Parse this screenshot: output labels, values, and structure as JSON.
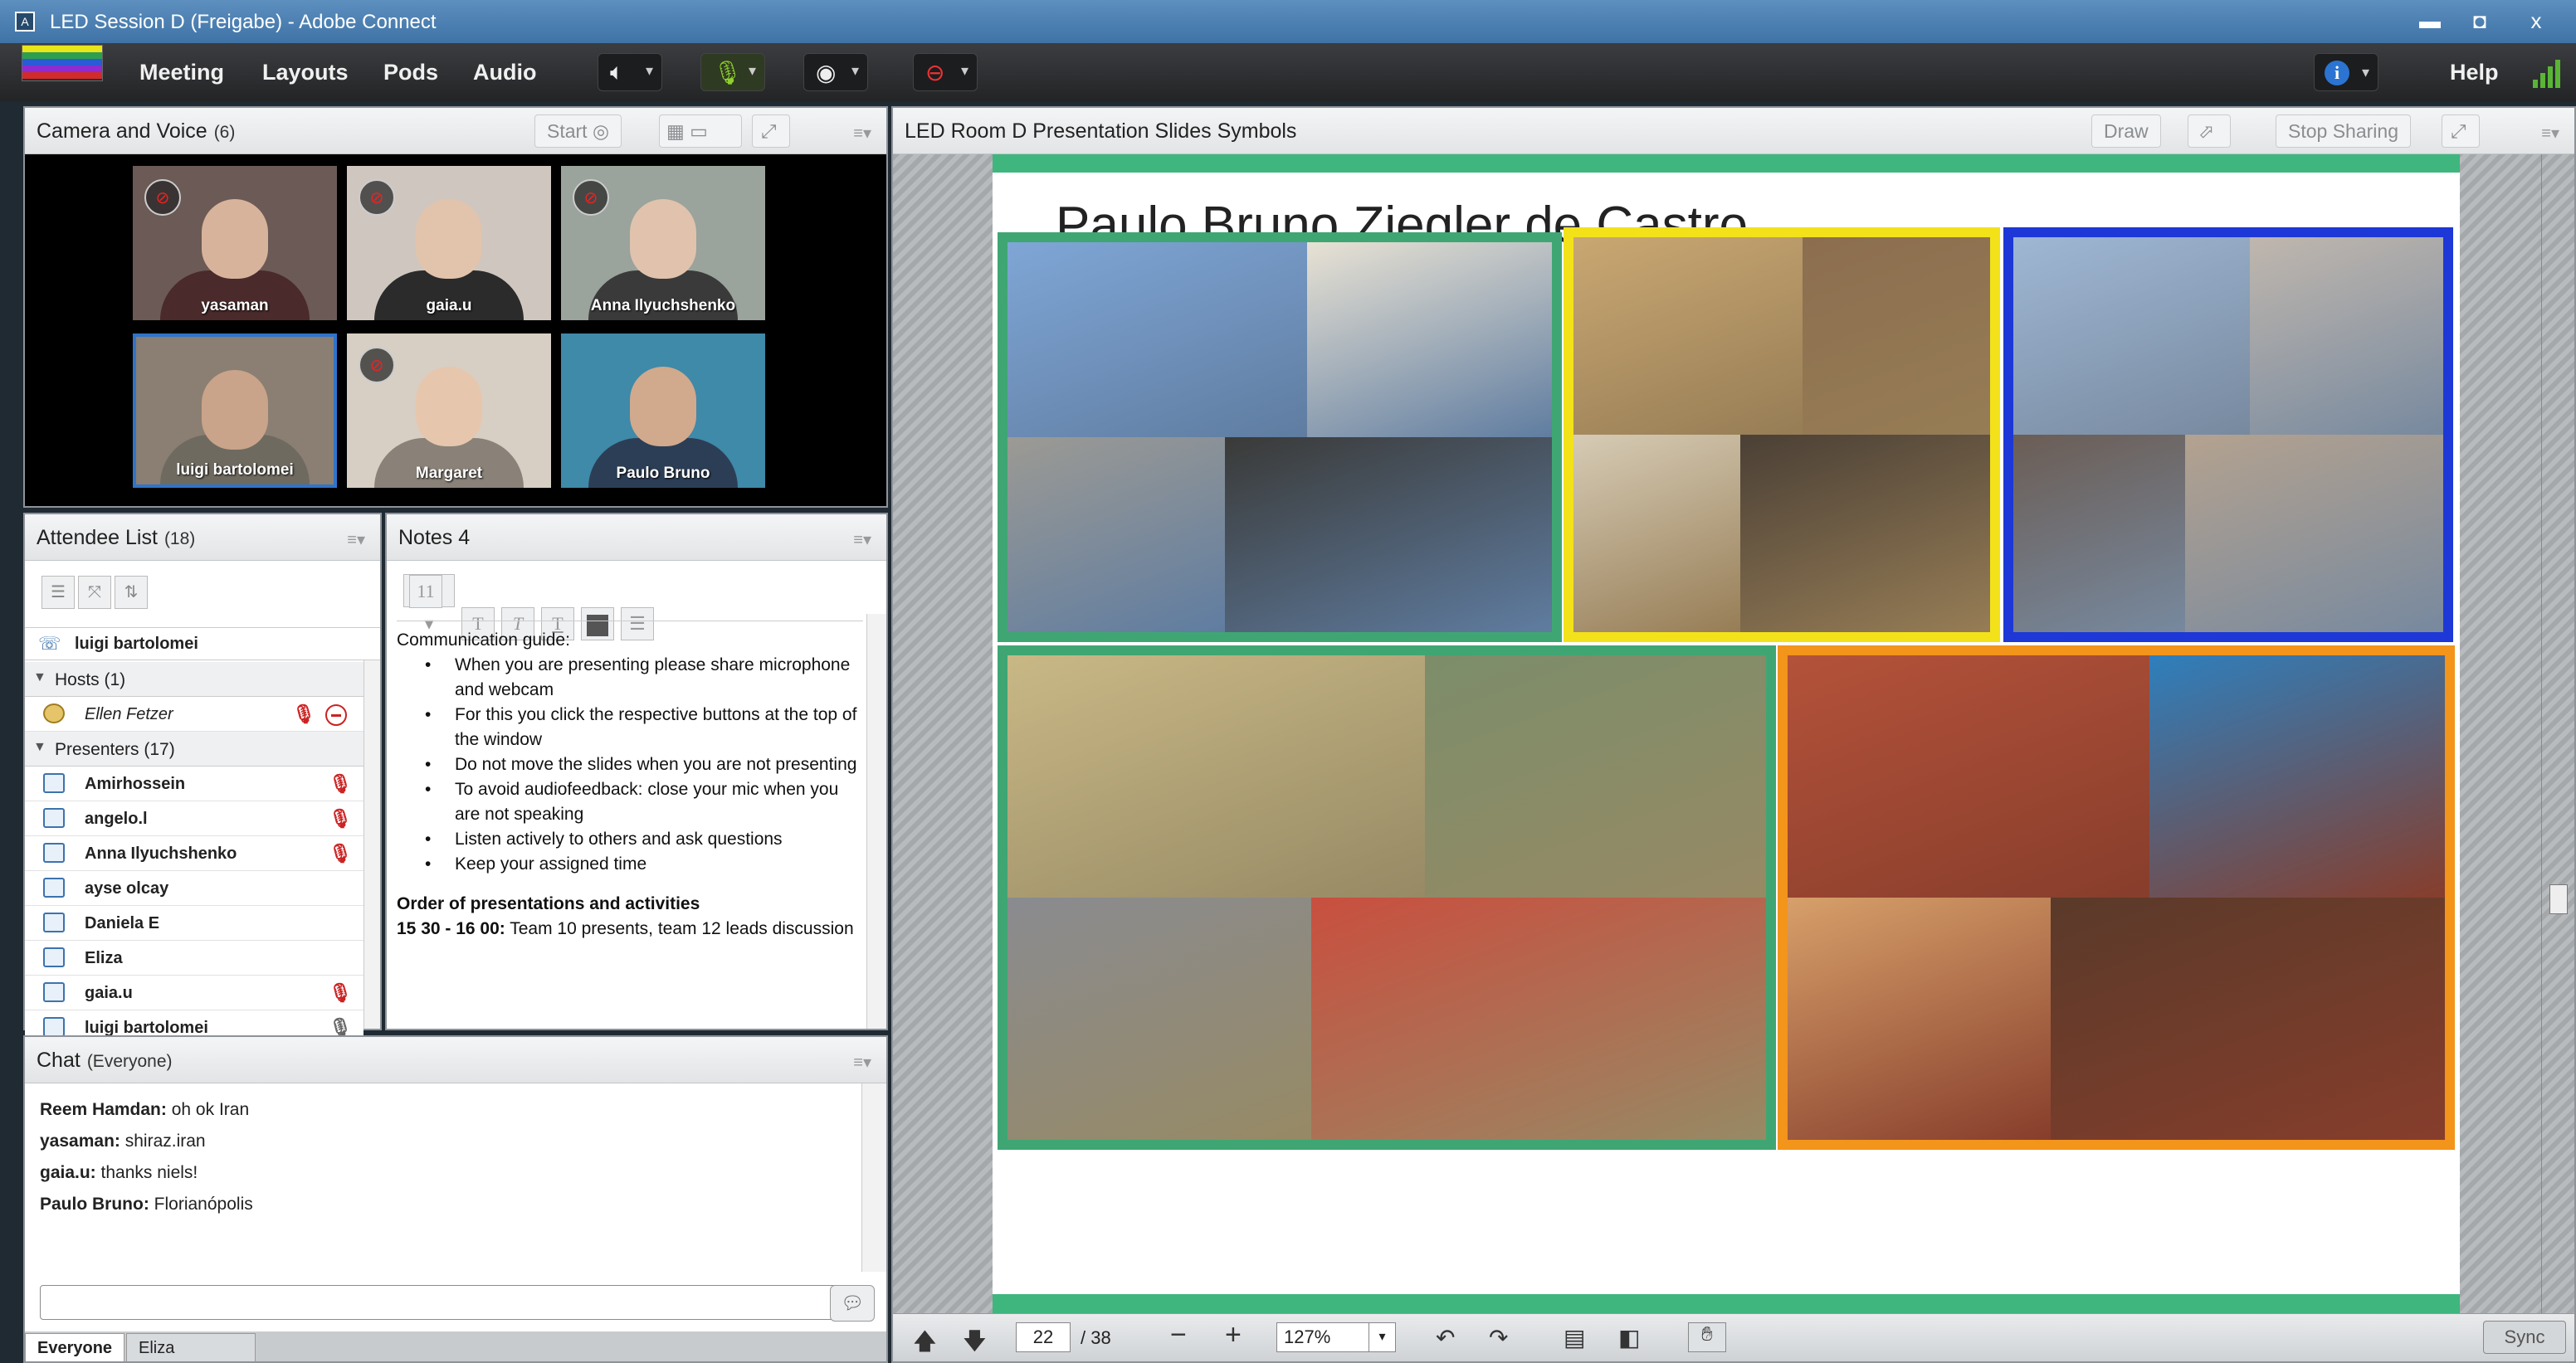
{
  "window": {
    "title": "LED Session D (Freigabe) - Adobe Connect",
    "minimize": "▬",
    "restore": "◘",
    "close": "x"
  },
  "menu": {
    "items": [
      "Meeting",
      "Layouts",
      "Pods",
      "Audio"
    ],
    "help": "Help",
    "logo_colors": [
      "#e8e51a",
      "#2e9e4f",
      "#2a5bd7",
      "#8e2bd1",
      "#d12b2b"
    ]
  },
  "toolbar": {
    "speaker_icon": "speaker-icon",
    "mic_icon": "microphone-muted-icon",
    "camera_icon": "webcam-icon",
    "status_icon": "status-icon"
  },
  "camera_pod": {
    "title": "Camera and Voice",
    "count": "(6)",
    "start_label": "Start",
    "participants": [
      {
        "name": "yasaman",
        "muted": true,
        "bg": "#6b5a55",
        "skin": "#d8b39c",
        "shirt": "#4a2a2a"
      },
      {
        "name": "gaia.u",
        "muted": true,
        "bg": "#cfc7bf",
        "skin": "#e2c3ac",
        "shirt": "#2b2b2b"
      },
      {
        "name": "Anna Ilyuchshenko",
        "muted": true,
        "bg": "#9aa39c",
        "skin": "#e0c2ad",
        "shirt": "#3a3a3a"
      },
      {
        "name": "luigi bartolomei",
        "muted": false,
        "bg": "#8a7f72",
        "skin": "#c9a48a",
        "shirt": "#6f6a60"
      },
      {
        "name": "Margaret",
        "muted": true,
        "bg": "#d7cfc4",
        "skin": "#e6c7ad",
        "shirt": "#8a8278"
      },
      {
        "name": "Paulo Bruno",
        "muted": false,
        "bg": "#3f89a9",
        "skin": "#d1a98c",
        "shirt": "#2c3e55"
      }
    ]
  },
  "attendee_pod": {
    "title": "Attendee List",
    "count": "(18)",
    "current_user": "luigi bartolomei",
    "hosts_label": "Hosts (1)",
    "hosts": [
      "Ellen Fetzer"
    ],
    "presenters_label": "Presenters (17)",
    "presenters": [
      {
        "name": "Amirhossein",
        "mic": "muted"
      },
      {
        "name": "angelo.l",
        "mic": "muted"
      },
      {
        "name": "Anna Ilyuchshenko",
        "mic": "muted"
      },
      {
        "name": "ayse olcay",
        "mic": ""
      },
      {
        "name": "Daniela E",
        "mic": ""
      },
      {
        "name": "Eliza",
        "mic": ""
      },
      {
        "name": "gaia.u",
        "mic": "muted"
      },
      {
        "name": "luigi bartolomei",
        "mic": "active"
      }
    ]
  },
  "notes_pod": {
    "title": "Notes 4",
    "font_size": "11",
    "heading": "Communication guide:",
    "bullets": [
      "When you are presenting please share microphone and webcam",
      "For this you click the respective buttons at the top of the window",
      "Do not move the slides when you are not presenting",
      "To avoid audiofeedback: close your mic when you are not speaking",
      "Listen actively to others and ask questions",
      "Keep your assigned time"
    ],
    "order_heading": "Order of presentations and activities",
    "order_time": "15 30 - 16 00:",
    "order_text": "Team 10 presents, team 12 leads discussion"
  },
  "chat_pod": {
    "title": "Chat",
    "scope": "(Everyone)",
    "messages": [
      {
        "sender": "Reem Hamdan:",
        "text": "oh ok Iran"
      },
      {
        "sender": "yasaman:",
        "text": "shiraz.iran"
      },
      {
        "sender": "gaia.u:",
        "text": "thanks niels!"
      },
      {
        "sender": "Paulo Bruno:",
        "text": "Florianópolis"
      }
    ],
    "input_placeholder": "",
    "tabs": [
      "Everyone",
      "Eliza"
    ]
  },
  "share_pod": {
    "title": "LED Room D Presentation Slides Symbols",
    "draw_label": "Draw",
    "stop_sharing_label": "Stop Sharing",
    "slide_title": "Paulo Bruno Ziegler de Castro",
    "page_current": "22",
    "page_total": "/ 38",
    "zoom": "127%",
    "sync_label": "Sync",
    "frame_colors": [
      "#3fa673",
      "#f3e21a",
      "#1d38d6",
      "#3fa673",
      "#f3941b"
    ]
  }
}
